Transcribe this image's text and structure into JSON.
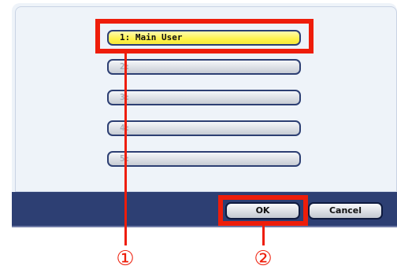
{
  "users": [
    {
      "label": "1: Main User",
      "selected": true
    },
    {
      "label": "2:",
      "selected": false
    },
    {
      "label": "3:",
      "selected": false
    },
    {
      "label": "4:",
      "selected": false
    },
    {
      "label": "5:",
      "selected": false
    }
  ],
  "buttons": {
    "ok": "OK",
    "cancel": "Cancel"
  },
  "callouts": {
    "one": "①",
    "two": "②"
  },
  "colors": {
    "highlight": "#ee1d0a",
    "selected_fill": "#fff24a",
    "bar": "#2d3f73"
  }
}
